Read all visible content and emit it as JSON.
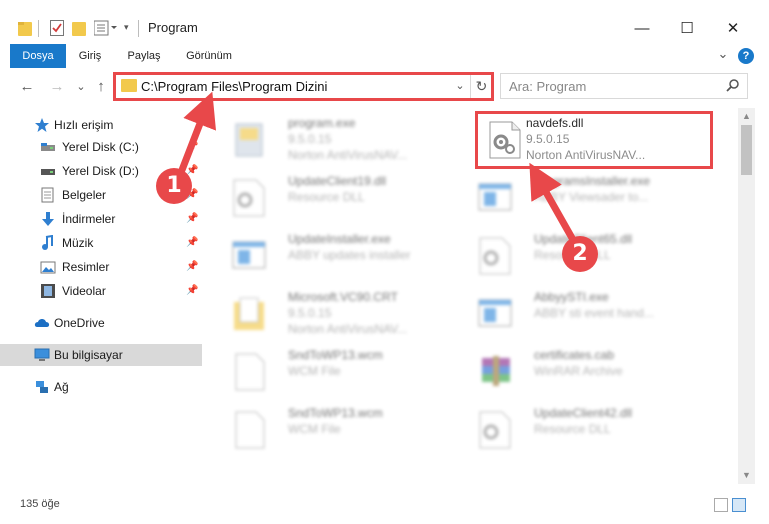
{
  "window": {
    "title": "Program",
    "minimize_glyph": "—",
    "maximize_glyph": "☐",
    "close_glyph": "✕"
  },
  "ribbon": {
    "tabs": [
      {
        "label": "Dosya",
        "active": true
      },
      {
        "label": "Giriş",
        "active": false
      },
      {
        "label": "Paylaş",
        "active": false
      },
      {
        "label": "Görünüm",
        "active": false
      }
    ],
    "expand_glyph": "⌄",
    "help_glyph": "?"
  },
  "navigation": {
    "back_glyph": "←",
    "forward_glyph": "→",
    "recent_glyph": "⌄",
    "up_glyph": "↑",
    "address": "C:\\Program Files\\Program Dizini",
    "address_dropdown_glyph": "⌄",
    "refresh_glyph": "↻",
    "search_placeholder": "Ara: Program"
  },
  "sidebar": {
    "items": [
      {
        "label": "Hızlı erişim",
        "icon": "star-icon",
        "pinned": false,
        "selected": false
      },
      {
        "label": "Yerel Disk (C:)",
        "icon": "drive-icon",
        "pinned": true,
        "selected": false
      },
      {
        "label": "Yerel Disk (D:)",
        "icon": "drive-icon",
        "pinned": true,
        "selected": false
      },
      {
        "label": "Belgeler",
        "icon": "documents-icon",
        "pinned": true,
        "selected": false
      },
      {
        "label": "İndirmeler",
        "icon": "download-icon",
        "pinned": true,
        "selected": false
      },
      {
        "label": "Müzik",
        "icon": "music-icon",
        "pinned": true,
        "selected": false
      },
      {
        "label": "Resimler",
        "icon": "pictures-icon",
        "pinned": true,
        "selected": false
      },
      {
        "label": "Videolar",
        "icon": "videos-icon",
        "pinned": true,
        "selected": false
      },
      {
        "label": "OneDrive",
        "icon": "cloud-icon",
        "pinned": false,
        "selected": false
      },
      {
        "label": "Bu bilgisayar",
        "icon": "computer-icon",
        "pinned": false,
        "selected": true
      },
      {
        "label": "Ağ",
        "icon": "network-icon",
        "pinned": false,
        "selected": false
      }
    ]
  },
  "files": [
    {
      "name": "program.exe",
      "line1": "9.5.0.15",
      "line2": "Norton AntiVirusNAV...",
      "icon": "exe-icon",
      "blurred": true
    },
    {
      "name": "navdefs.dll",
      "line1": "9.5.0.15",
      "line2": "Norton AntiVirusNAV...",
      "icon": "dll-gear-icon",
      "blurred": false
    },
    {
      "name": "UpdateClient19.dll",
      "line1": "Resource DLL",
      "line2": "",
      "icon": "dll-gear-icon",
      "blurred": true
    },
    {
      "name": "ProgramsInstaller.exe",
      "line1": "ABBY Viewsader to...",
      "line2": "",
      "icon": "app-window-icon",
      "blurred": true
    },
    {
      "name": "UpdateInstaller.exe",
      "line1": "ABBY updates installer",
      "line2": "",
      "icon": "app-window-icon",
      "blurred": true
    },
    {
      "name": "UpdateClient65.dll",
      "line1": "Resource DLL",
      "line2": "",
      "icon": "dll-gear-icon",
      "blurred": true
    },
    {
      "name": "Microsoft.VC90.CRT",
      "line1": "9.5.0.15",
      "line2": "Norton AntiVirusNAV...",
      "icon": "folder-doc-icon",
      "blurred": true
    },
    {
      "name": "AbbyySTI.exe",
      "line1": "ABBY sti event hand...",
      "line2": "",
      "icon": "app-window-icon",
      "blurred": true
    },
    {
      "name": "SndToWP13.wcm",
      "line1": "WCM File",
      "line2": "",
      "icon": "blank-file-icon",
      "blurred": true
    },
    {
      "name": "certificates.cab",
      "line1": "WinRAR Archive",
      "line2": "",
      "icon": "winrar-icon",
      "blurred": true
    },
    {
      "name": "SndToWP13.wcm",
      "line1": "WCM File",
      "line2": "",
      "icon": "blank-file-icon",
      "blurred": true
    },
    {
      "name": "UpdateClient42.dll",
      "line1": "Resource DLL",
      "line2": "",
      "icon": "dll-gear-icon",
      "blurred": true
    }
  ],
  "status": {
    "item_count": "135 öğe"
  },
  "callouts": [
    {
      "number": "1"
    },
    {
      "number": "2"
    }
  ],
  "colors": {
    "accent": "#1979ca",
    "highlight": "#e8484a",
    "folder": "#f2c94c"
  }
}
